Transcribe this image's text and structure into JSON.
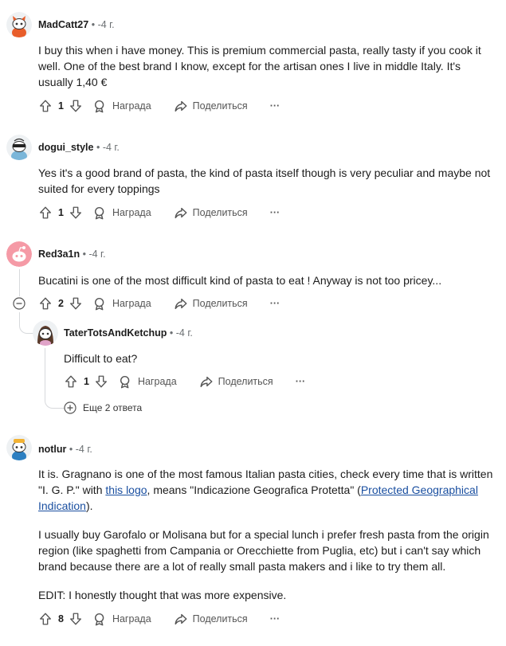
{
  "labels": {
    "award": "Награда",
    "share": "Поделиться",
    "more": "···"
  },
  "comments": [
    {
      "author": "MadCatt27",
      "age": "-4 г.",
      "text": "I buy this when i have money. This is premium commercial pasta, really tasty if you cook it well. One of the best brand I know, except for the artisan ones I live in middle Italy. It's usually 1,40 €",
      "votes": "1"
    },
    {
      "author": "dogui_style",
      "age": "-4 г.",
      "text": "Yes it's a good brand of pasta, the kind of pasta itself though is very peculiar and maybe not suited for every toppings",
      "votes": "1"
    },
    {
      "author": "Red3a1n",
      "age": "-4 г.",
      "text": "Bucatini is one of the most difficult kind of pasta to eat ! Anyway is not too pricey...",
      "votes": "2"
    },
    {
      "author": "TaterTotsAndKetchup",
      "age": "-4 г.",
      "text": "Difficult to eat?",
      "votes": "1",
      "more_replies": "Еще 2 ответа"
    },
    {
      "author": "notlur",
      "age": "-4 г.",
      "p1_a": "It is. Gragnano is one of the most famous Italian pasta cities, check every time that is written \"I. G. P.\" with ",
      "p1_link1": "this logo",
      "p1_b": ", means \"Indicazione Geografica Protetta\" (",
      "p1_link2": "Protected Geographical Indication",
      "p1_c": ").",
      "p2": "I usually buy Garofalo or Molisana but for a special lunch i prefer fresh pasta from the origin region (like spaghetti from Campania or Orecchiette from Puglia, etc) but i can't say which brand because there are a lot of really small pasta makers and i like to try them all.",
      "p3": "EDIT: I honestly thought that was more expensive.",
      "votes": "8"
    }
  ]
}
